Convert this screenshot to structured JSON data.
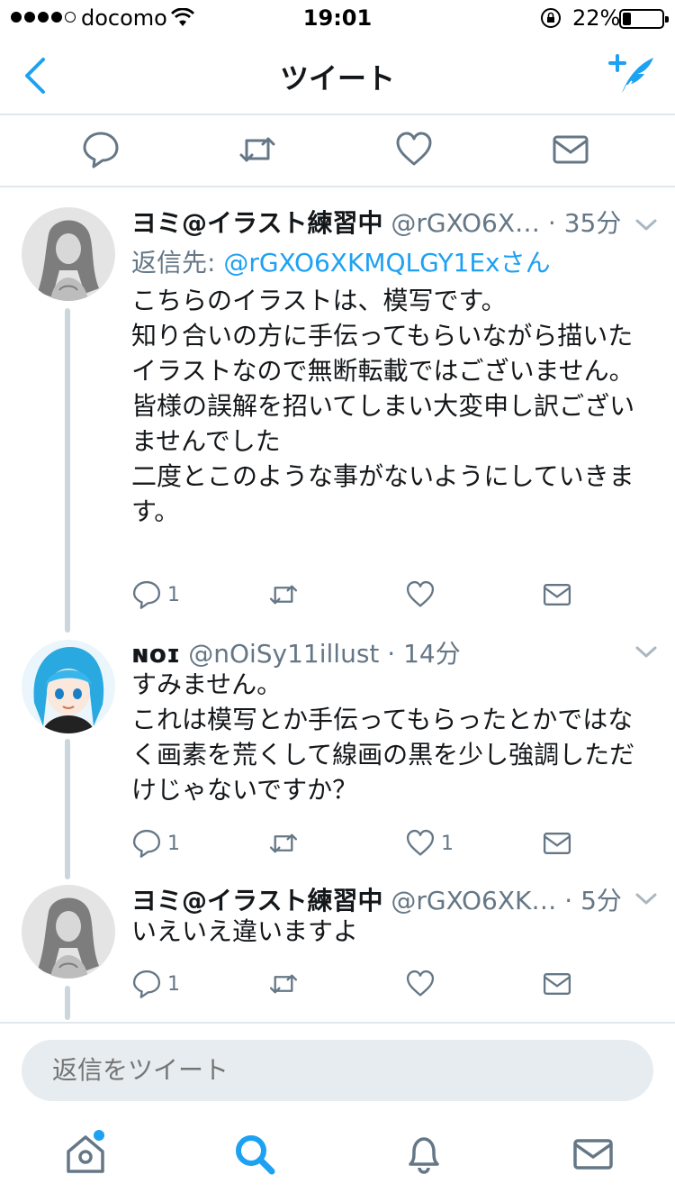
{
  "status_bar": {
    "carrier": "docomo",
    "time": "19:01",
    "battery": "22%",
    "battery_level": 0.22
  },
  "nav": {
    "title": "ツイート",
    "back_icon": "chevron-left-icon",
    "compose_icon": "compose-tweet-icon"
  },
  "top_actions": [
    "reply-icon",
    "retweet-icon",
    "heart-icon",
    "message-icon"
  ],
  "tweets": [
    {
      "name": "ヨミ@イラスト練習中",
      "handle": "@rGXO6X…",
      "time": "· 35分",
      "reply_prefix": "返信先: ",
      "reply_to": "@rGXO6XKMQLGY1Exさん",
      "text": "こちらのイラストは、模写です。\n知り合いの方に手伝ってもらいながら描いたイラストなので無断転載ではございません。\n皆様の誤解を招いてしまい大変申し訳ございませんでした\n二度とこのような事がないようにしていきます。",
      "reply_count": "1",
      "retweet_count": "",
      "like_count": ""
    },
    {
      "name": "ɴᴏɪ",
      "handle": "@nOiSy11illust",
      "time": "· 14分",
      "text": "すみません。\nこれは模写とか手伝ってもらったとかではなく画素を荒くして線画の黒を少し強調しただけじゃないですか？",
      "reply_count": "1",
      "retweet_count": "",
      "like_count": "1"
    },
    {
      "name": "ヨミ@イラスト練習中",
      "handle": "@rGXO6XK…",
      "time": "· 5分",
      "text": "いえいえ違いますよ",
      "reply_count": "1",
      "retweet_count": "",
      "like_count": ""
    }
  ],
  "reply_bar": {
    "placeholder": "返信をツイート"
  },
  "tab_bar": [
    "home-icon",
    "search-icon",
    "notifications-icon",
    "messages-icon"
  ],
  "colors": {
    "accent": "#1da1f2",
    "gray_text": "#657786",
    "divider": "#e1e8ed",
    "thread_line": "#ccd6dd"
  }
}
